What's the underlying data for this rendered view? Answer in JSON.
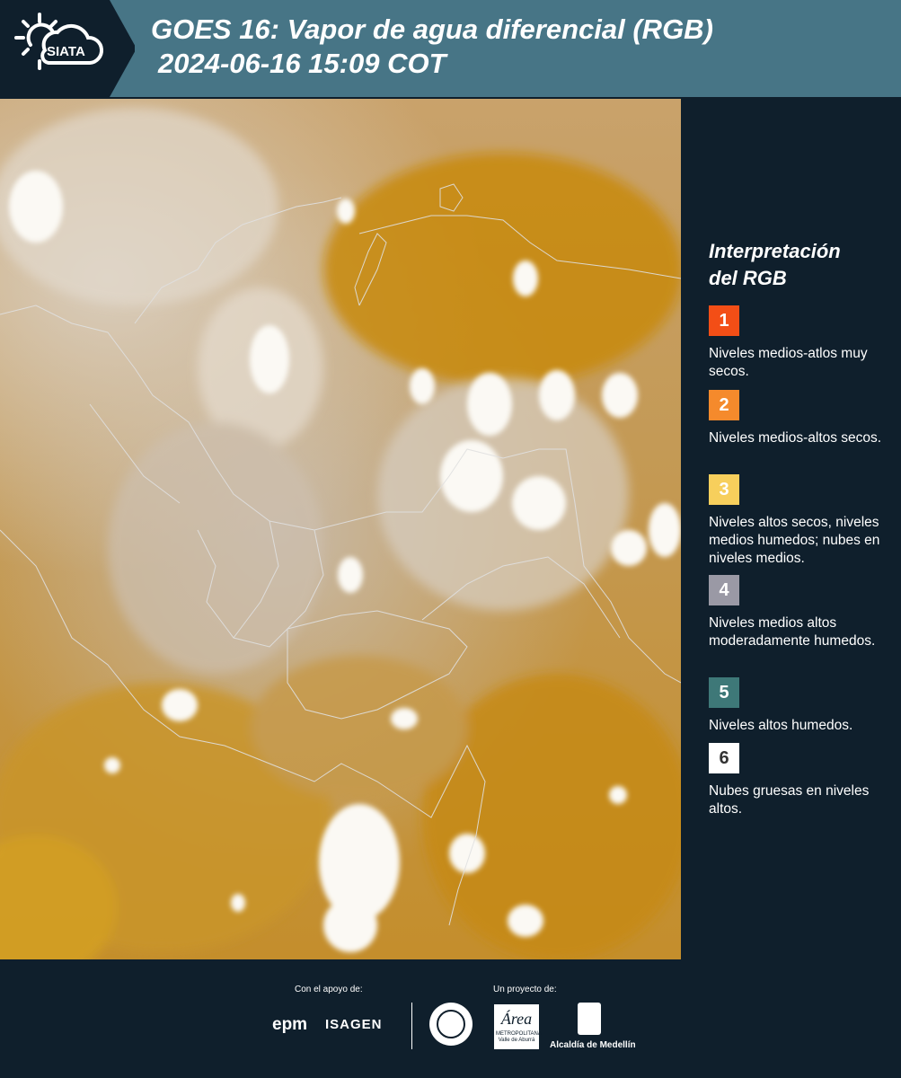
{
  "header": {
    "logo_text": "SIATA",
    "title_line1": "GOES 16: Vapor de agua diferencial (RGB)",
    "title_line2": "2024-06-16 15:09 COT"
  },
  "legend": {
    "title_line1": "Interpretación",
    "title_line2": "del RGB",
    "items": [
      {
        "number": "1",
        "color": "#f34e16",
        "text_color": "#ffffff",
        "text": "Niveles medios-atlos muy secos."
      },
      {
        "number": "2",
        "color": "#f58a2c",
        "text_color": "#ffffff",
        "text": "Niveles medios-altos secos."
      },
      {
        "number": "3",
        "color": "#f7cf5c",
        "text_color": "#ffffff",
        "text": "Niveles altos secos, niveles medios humedos; nubes en niveles medios."
      },
      {
        "number": "4",
        "color": "#9a99a5",
        "text_color": "#ffffff",
        "text": "Niveles medios altos moderadamente humedos."
      },
      {
        "number": "5",
        "color": "#3e7878",
        "text_color": "#ffffff",
        "text": "Niveles altos humedos."
      },
      {
        "number": "6",
        "color": "#ffffff",
        "text_color": "#333333",
        "text": "Nubes gruesas en niveles altos."
      }
    ]
  },
  "footer": {
    "support_label": "Con el apoyo de:",
    "project_label": "Un proyecto de:",
    "epm": "epm",
    "isagen": "ISAGEN",
    "metro_name": "Área",
    "metro_sub": "METROPOLITANA Valle de Aburrá",
    "alcaldia": "Alcaldía de Medellín"
  }
}
